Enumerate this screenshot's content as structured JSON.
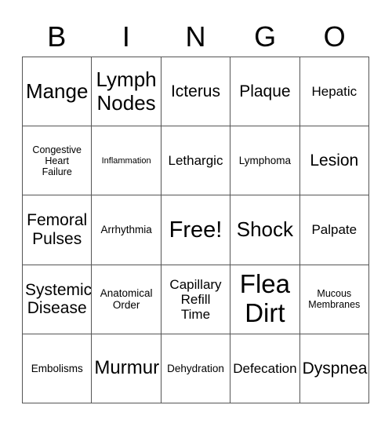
{
  "card": {
    "header_letters": [
      "B",
      "I",
      "N",
      "G",
      "O"
    ],
    "rows": [
      [
        {
          "label": "Mange",
          "size": "fs-xxl"
        },
        {
          "label": "Lymph\nNodes",
          "size": "fs-xxl"
        },
        {
          "label": "Icterus",
          "size": "fs-l"
        },
        {
          "label": "Plaque",
          "size": "fs-l"
        },
        {
          "label": "Hepatic",
          "size": "fs-m"
        }
      ],
      [
        {
          "label": "Congestive\nHeart\nFailure",
          "size": "fs-s"
        },
        {
          "label": "Inflammation",
          "size": "fs-xs"
        },
        {
          "label": "Lethargic",
          "size": "fs-m"
        },
        {
          "label": "Lymphoma",
          "size": "fs-sm"
        },
        {
          "label": "Lesion",
          "size": "fs-l"
        }
      ],
      [
        {
          "label": "Femoral\nPulses",
          "size": "fs-l"
        },
        {
          "label": "Arrhythmia",
          "size": "fs-sm"
        },
        {
          "label": "Free!",
          "size": "fs-3xl"
        },
        {
          "label": "Shock",
          "size": "fs-xxl"
        },
        {
          "label": "Palpate",
          "size": "fs-m"
        }
      ],
      [
        {
          "label": "Systemic\nDisease",
          "size": "fs-l"
        },
        {
          "label": "Anatomical\nOrder",
          "size": "fs-sm"
        },
        {
          "label": "Capillary\nRefill\nTime",
          "size": "fs-m"
        },
        {
          "label": "Flea\nDirt",
          "size": "fs-4xl"
        },
        {
          "label": "Mucous\nMembranes",
          "size": "fs-s"
        }
      ],
      [
        {
          "label": "Embolisms",
          "size": "fs-sm"
        },
        {
          "label": "Murmur",
          "size": "fs-xl"
        },
        {
          "label": "Dehydration",
          "size": "fs-sm"
        },
        {
          "label": "Defecation",
          "size": "fs-m"
        },
        {
          "label": "Dyspnea",
          "size": "fs-l"
        }
      ]
    ]
  }
}
